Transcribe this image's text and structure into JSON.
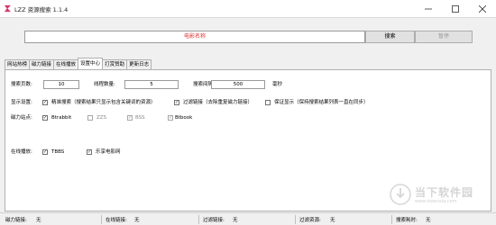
{
  "window": {
    "title": "LZZ 资源搜索 1.1.4"
  },
  "search": {
    "placeholder": "电影名称",
    "search_label": "搜索",
    "pause_label": "暂停"
  },
  "tabs": [
    {
      "label": "网站热榜",
      "active": false
    },
    {
      "label": "磁力链接",
      "active": false
    },
    {
      "label": "在线播放",
      "active": false
    },
    {
      "label": "设置中心",
      "active": true
    },
    {
      "label": "打赏赞助",
      "active": false
    },
    {
      "label": "更新日志",
      "active": false
    }
  ],
  "settings": {
    "search_pages_label": "搜索页数:",
    "search_pages_value": "10",
    "threads_label": "线程数量:",
    "threads_value": "5",
    "interval_label": "搜索间隔:",
    "interval_value": "500",
    "interval_unit": "毫秒",
    "display_label": "显示设置:",
    "precise_search": {
      "label": "精准搜索（搜索结果只显示包含关键词的资源）",
      "checked": true
    },
    "filter_links": {
      "label": "过滤链接（去除重复磁力链接）",
      "checked": true
    },
    "keep_on_top": {
      "label": "保证显示（保持搜索结果列表一直在同步）",
      "checked": false
    },
    "magnet_sites_label": "磁力站点:",
    "magnet_sites": [
      {
        "label": "Btrabbit",
        "checked": true,
        "enabled": true
      },
      {
        "label": "ZZS",
        "checked": false,
        "enabled": false
      },
      {
        "label": "BSS",
        "checked": true,
        "enabled": false
      },
      {
        "label": "Btbook",
        "checked": true,
        "enabled": false
      }
    ],
    "online_label": "在线播放:",
    "online_sites": [
      {
        "label": "TBBS",
        "checked": true
      },
      {
        "label": "乐享电影网",
        "checked": true
      }
    ]
  },
  "status": {
    "magnet_label": "磁力链接:",
    "magnet_value": "无",
    "online_label": "在线链接:",
    "online_value": "无",
    "filtered_links_label": "过滤链接:",
    "filtered_links_value": "无",
    "filtered_res_label": "过滤资源:",
    "filtered_res_value": "无",
    "time_label": "搜索耗时:",
    "time_value": "无"
  },
  "watermark": {
    "title": "当下软件园",
    "subtitle": "www.downxia.com"
  },
  "colors": {
    "placeholder": "#e03030",
    "window_bg": "#f0f0f0",
    "panel_bg": "#ffffff"
  }
}
